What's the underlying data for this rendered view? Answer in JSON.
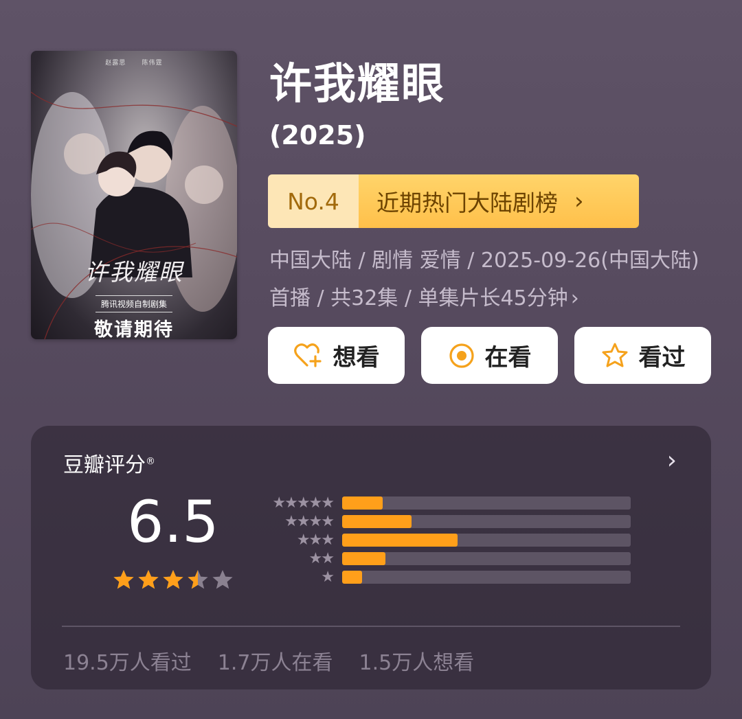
{
  "poster": {
    "cast_left": "赵露思",
    "cast_right": "陈伟霆",
    "title_text": "许我耀眼",
    "subtitle": "腾讯视频自制剧集",
    "bottom_text": "敬请期待"
  },
  "show": {
    "title": "许我耀眼",
    "year": "(2025)"
  },
  "rank": {
    "number": "No.4",
    "label": "近期热门大陆剧榜",
    "chevron": "›"
  },
  "meta": {
    "text": "中国大陆 / 剧情 爱情 / 2025-09-26(中国大陆)首播 / 共32集 / 单集片长45分钟",
    "chevron": "›"
  },
  "actions": [
    {
      "label": "想看",
      "icon": "heart-plus-icon"
    },
    {
      "label": "在看",
      "icon": "target-icon"
    },
    {
      "label": "看过",
      "icon": "star-icon"
    }
  ],
  "rating": {
    "title": "豆瓣评分",
    "registered_mark": "®",
    "chevron": "›",
    "score": "6.5",
    "stars": 3.5,
    "distribution": [
      {
        "stars": "★★★★★",
        "fraction": 0.14
      },
      {
        "stars": "★★★★",
        "fraction": 0.24
      },
      {
        "stars": "★★★",
        "fraction": 0.4
      },
      {
        "stars": "★★",
        "fraction": 0.15
      },
      {
        "stars": "★",
        "fraction": 0.07
      }
    ],
    "colors": {
      "star": "#ff9f1a",
      "star_empty": "#8a8190",
      "bar": "#ff9f1a"
    }
  },
  "watchers": {
    "watched": "19.5万人看过",
    "watching": "1.7万人在看",
    "want": "1.5万人想看"
  }
}
